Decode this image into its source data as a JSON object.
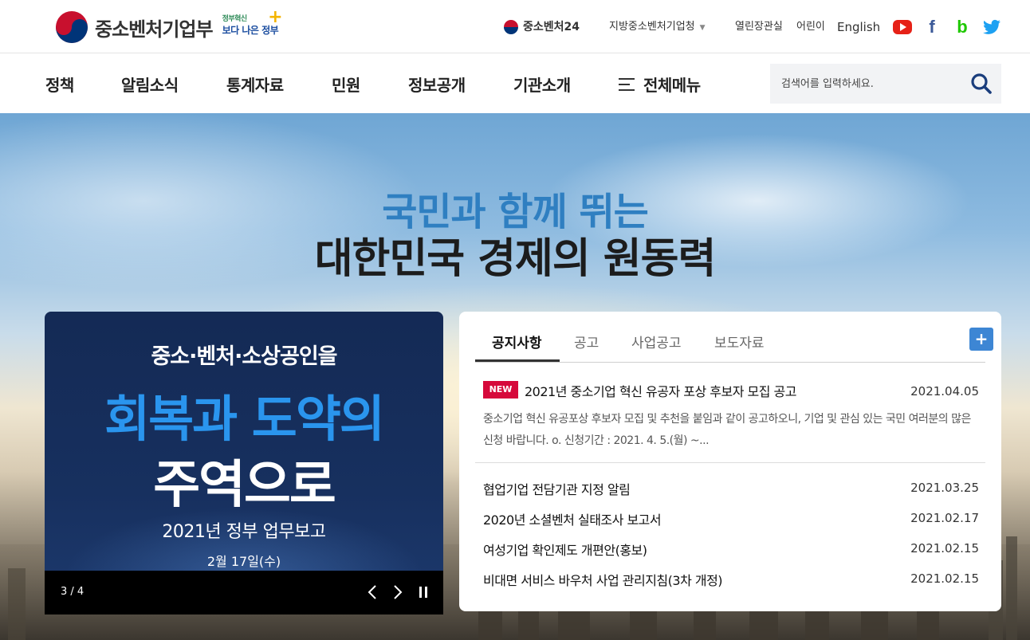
{
  "header": {
    "logo_text": "중소벤처기업부",
    "gov_badge": {
      "small": "정부혁신",
      "big": "보다 나은 정부"
    },
    "links": [
      "중소벤처24",
      "지방중소벤처기업청",
      "열린장관실",
      "어린이",
      "English"
    ],
    "sns": [
      "youtube-icon",
      "facebook-icon",
      "blog-icon",
      "twitter-icon"
    ]
  },
  "gnb": {
    "items": [
      "정책",
      "알림소식",
      "통계자료",
      "민원",
      "정보공개",
      "기관소개"
    ],
    "all_menu": "전체메뉴",
    "search_placeholder": "검색어를 입력하세요."
  },
  "hero": {
    "line1": "국민과 함께 뛰는",
    "line2": "대한민국 경제의 원동력"
  },
  "banner": {
    "line1": "중소·벤처·소상공인을",
    "line2": "회복과 도약의",
    "line3": "주역으로",
    "line4": "2021년 정부 업무보고",
    "line5": "2월 17일(수)",
    "counter": "3 / 4"
  },
  "notice": {
    "tabs": [
      "공지사항",
      "공고",
      "사업공고",
      "보도자료"
    ],
    "more_label": "+",
    "featured": {
      "badge": "NEW",
      "title": "2021년 중소기업 혁신 유공자 포상 후보자 모집 공고",
      "date": "2021.04.05",
      "desc": "중소기업 혁신 유공포상 후보자 모집 및 추천을 붙임과 같이 공고하오니, 기업 및 관심 있는 국민 여러분의 많은 신청 바랍니다. o. 신청기간 : 2021. 4. 5.(월) ~..."
    },
    "items": [
      {
        "title": "협업기업 전담기관 지정 알림",
        "date": "2021.03.25"
      },
      {
        "title": "2020년 소셜벤처 실태조사 보고서",
        "date": "2021.02.17"
      },
      {
        "title": "여성기업 확인제도 개편안(홍보)",
        "date": "2021.02.15"
      },
      {
        "title": "비대면 서비스 바우처 사업 관리지침(3차 개정)",
        "date": "2021.02.15"
      }
    ]
  },
  "colors": {
    "accent": "#3d86d4",
    "new_badge": "#d6093b",
    "hero_blue": "#2f7fc1",
    "banner_blue": "#2a95ee"
  }
}
